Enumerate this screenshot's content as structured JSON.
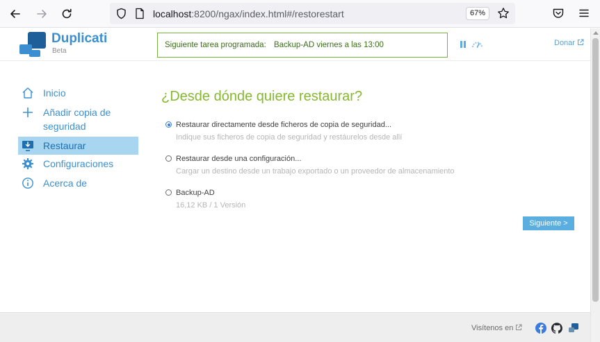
{
  "browser": {
    "url_host": "localhost",
    "url_path": ":8200/ngax/index.html#/restorestart",
    "zoom": "67%"
  },
  "header": {
    "app_name": "Duplicati",
    "app_sub": "Beta",
    "schedule_label": "Siguiente tarea programada:",
    "schedule_value": "Backup-AD viernes a las 13:00",
    "donate": "Donar"
  },
  "sidebar": {
    "items": [
      {
        "label": "Inicio",
        "icon": "home-icon"
      },
      {
        "label": "Añadir copia de seguridad",
        "icon": "plus-icon"
      },
      {
        "label": "Restaurar",
        "icon": "restore-icon"
      },
      {
        "label": "Configuraciones",
        "icon": "gear-icon"
      },
      {
        "label": "Acerca de",
        "icon": "info-icon"
      }
    ],
    "active_index": 2
  },
  "main": {
    "heading": "¿Desde dónde quiere restaurar?",
    "options": [
      {
        "title": "Restaurar directamente desde ficheros de copia de seguridad...",
        "desc": "Indique sus ficheros de copia de seguridad y restáurelos desde allí",
        "checked": true
      },
      {
        "title": "Restaurar desde una configuración...",
        "desc": "Cargar un destino desde un trabajo exportado o un proveedor de almacenamiento",
        "checked": false
      },
      {
        "title": "Backup-AD",
        "desc": "16,12 KB / 1 Versión",
        "checked": false
      }
    ],
    "next_button": "Siguiente >"
  },
  "footer": {
    "visit": "Visítenos en"
  },
  "colors": {
    "accent_blue": "#3b8fd0",
    "heading_green": "#86b830",
    "active_bg": "#a8d6f0",
    "button_blue": "#5aaee0"
  }
}
